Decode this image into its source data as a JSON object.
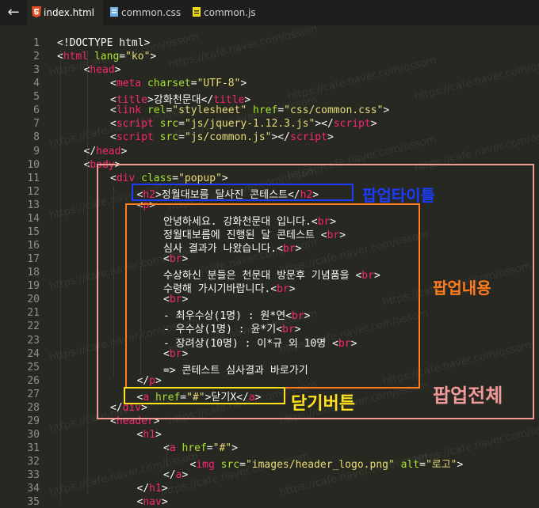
{
  "tabs": [
    {
      "label": "index.html",
      "icon": "html5-icon"
    },
    {
      "label": "common.css",
      "icon": "css-file-icon"
    },
    {
      "label": "common.js",
      "icon": "js-file-icon"
    }
  ],
  "watermark": "https://cafe.naver.com/ossom",
  "colors": {
    "tag": "#f92672",
    "attr": "#a6e22e",
    "string": "#e6db74",
    "text": "#f8f8f2",
    "linenum": "#8f908a",
    "bg": "#272822"
  },
  "lines": [
    {
      "n": "1",
      "indent": 0,
      "parts": [
        [
          "p",
          "<!DOCTYPE html>"
        ]
      ]
    },
    {
      "n": "2",
      "indent": 0,
      "parts": [
        [
          "p",
          "<"
        ],
        [
          "t",
          "html"
        ],
        [
          "p",
          " "
        ],
        [
          "a",
          "lang"
        ],
        [
          "p",
          "="
        ],
        [
          "s",
          "\"ko\""
        ],
        [
          "p",
          ">"
        ]
      ]
    },
    {
      "n": "3",
      "indent": 1,
      "parts": [
        [
          "p",
          "<"
        ],
        [
          "t",
          "head"
        ],
        [
          "p",
          ">"
        ]
      ]
    },
    {
      "n": "4",
      "indent": 2,
      "parts": [
        [
          "p",
          "<"
        ],
        [
          "t",
          "meta"
        ],
        [
          "p",
          " "
        ],
        [
          "a",
          "charset"
        ],
        [
          "p",
          "="
        ],
        [
          "s",
          "\"UTF-8\""
        ],
        [
          "p",
          ">"
        ]
      ]
    },
    {
      "n": "5",
      "indent": 2,
      "parts": [
        [
          "p",
          "<"
        ],
        [
          "t",
          "title"
        ],
        [
          "p",
          ">강화천문대</"
        ],
        [
          "t",
          "title"
        ],
        [
          "p",
          ">"
        ]
      ]
    },
    {
      "n": "6",
      "indent": 2,
      "parts": [
        [
          "p",
          "<"
        ],
        [
          "t",
          "link"
        ],
        [
          "p",
          " "
        ],
        [
          "a",
          "rel"
        ],
        [
          "p",
          "="
        ],
        [
          "s",
          "\"stylesheet\""
        ],
        [
          "p",
          " "
        ],
        [
          "a",
          "href"
        ],
        [
          "p",
          "="
        ],
        [
          "s",
          "\"css/common.css\""
        ],
        [
          "p",
          ">"
        ]
      ]
    },
    {
      "n": "7",
      "indent": 2,
      "parts": [
        [
          "p",
          "<"
        ],
        [
          "t",
          "script"
        ],
        [
          "p",
          " "
        ],
        [
          "a",
          "src"
        ],
        [
          "p",
          "="
        ],
        [
          "s",
          "\"js/jquery-1.12.3.js\""
        ],
        [
          "p",
          "></"
        ],
        [
          "t",
          "script"
        ],
        [
          "p",
          ">"
        ]
      ]
    },
    {
      "n": "8",
      "indent": 2,
      "parts": [
        [
          "p",
          "<"
        ],
        [
          "t",
          "script"
        ],
        [
          "p",
          " "
        ],
        [
          "a",
          "src"
        ],
        [
          "p",
          "="
        ],
        [
          "s",
          "\"js/common.js\""
        ],
        [
          "p",
          "></"
        ],
        [
          "t",
          "script"
        ],
        [
          "p",
          ">"
        ]
      ]
    },
    {
      "n": "9",
      "indent": 1,
      "parts": [
        [
          "p",
          "</"
        ],
        [
          "t",
          "head"
        ],
        [
          "p",
          ">"
        ]
      ]
    },
    {
      "n": "10",
      "indent": 1,
      "parts": [
        [
          "p",
          "<"
        ],
        [
          "t",
          "body"
        ],
        [
          "p",
          ">"
        ]
      ]
    },
    {
      "n": "11",
      "indent": 2,
      "parts": [
        [
          "p",
          "<"
        ],
        [
          "t",
          "div"
        ],
        [
          "p",
          " "
        ],
        [
          "a",
          "class"
        ],
        [
          "p",
          "="
        ],
        [
          "s",
          "\"popup\""
        ],
        [
          "p",
          ">"
        ]
      ]
    },
    {
      "n": "12",
      "indent": 3,
      "parts": [
        [
          "p",
          "<"
        ],
        [
          "t",
          "h2"
        ],
        [
          "p",
          ">정월대보름 달사진 콘테스트</"
        ],
        [
          "t",
          "h2"
        ],
        [
          "p",
          ">"
        ]
      ]
    },
    {
      "n": "13",
      "indent": 3,
      "parts": [
        [
          "p",
          "<"
        ],
        [
          "t",
          "p"
        ],
        [
          "p",
          ">"
        ]
      ]
    },
    {
      "n": "14",
      "indent": 4,
      "parts": [
        [
          "p",
          "안녕하세요. 강화천문대 입니다.<"
        ],
        [
          "t",
          "br"
        ],
        [
          "p",
          ">"
        ]
      ]
    },
    {
      "n": "15",
      "indent": 4,
      "parts": [
        [
          "p",
          "정월대보름에 진행된 달 콘테스트 <"
        ],
        [
          "t",
          "br"
        ],
        [
          "p",
          ">"
        ]
      ]
    },
    {
      "n": "16",
      "indent": 4,
      "parts": [
        [
          "p",
          "심사 결과가 나왔습니다.<"
        ],
        [
          "t",
          "br"
        ],
        [
          "p",
          ">"
        ]
      ]
    },
    {
      "n": "17",
      "indent": 4,
      "parts": [
        [
          "p",
          "<"
        ],
        [
          "t",
          "br"
        ],
        [
          "p",
          ">"
        ]
      ]
    },
    {
      "n": "18",
      "indent": 4,
      "parts": [
        [
          "p",
          "수상하신 분들은 천문대 방문후 기념품을 <"
        ],
        [
          "t",
          "br"
        ],
        [
          "p",
          ">"
        ]
      ]
    },
    {
      "n": "19",
      "indent": 4,
      "parts": [
        [
          "p",
          "수령해 가시기바랍니다.<"
        ],
        [
          "t",
          "br"
        ],
        [
          "p",
          ">"
        ]
      ]
    },
    {
      "n": "20",
      "indent": 4,
      "parts": [
        [
          "p",
          "<"
        ],
        [
          "t",
          "br"
        ],
        [
          "p",
          ">"
        ]
      ]
    },
    {
      "n": "21",
      "indent": 4,
      "parts": [
        [
          "p",
          "- 최우수상(1명) : 원*연<"
        ],
        [
          "t",
          "br"
        ],
        [
          "p",
          ">"
        ]
      ]
    },
    {
      "n": "22",
      "indent": 4,
      "parts": [
        [
          "p",
          "- 우수상(1명) : 윤*기<"
        ],
        [
          "t",
          "br"
        ],
        [
          "p",
          ">"
        ]
      ]
    },
    {
      "n": "23",
      "indent": 4,
      "parts": [
        [
          "p",
          "- 장려상(10명) : 이*규 외 10명 <"
        ],
        [
          "t",
          "br"
        ],
        [
          "p",
          ">"
        ]
      ]
    },
    {
      "n": "24",
      "indent": 4,
      "parts": [
        [
          "p",
          "<"
        ],
        [
          "t",
          "br"
        ],
        [
          "p",
          ">"
        ]
      ]
    },
    {
      "n": "25",
      "indent": 4,
      "parts": [
        [
          "p",
          "=> 콘테스트 심사결과 바로가기"
        ]
      ]
    },
    {
      "n": "26",
      "indent": 3,
      "parts": [
        [
          "p",
          "</"
        ],
        [
          "t",
          "p"
        ],
        [
          "p",
          ">"
        ]
      ]
    },
    {
      "n": "27",
      "indent": 3,
      "parts": [
        [
          "p",
          "<"
        ],
        [
          "t",
          "a"
        ],
        [
          "p",
          " "
        ],
        [
          "a",
          "href"
        ],
        [
          "p",
          "="
        ],
        [
          "s",
          "\"#\""
        ],
        [
          "p",
          ">닫기X</"
        ],
        [
          "t",
          "a"
        ],
        [
          "p",
          ">"
        ]
      ]
    },
    {
      "n": "28",
      "indent": 2,
      "parts": [
        [
          "p",
          "</"
        ],
        [
          "t",
          "div"
        ],
        [
          "p",
          ">"
        ]
      ]
    },
    {
      "n": "29",
      "indent": 2,
      "parts": [
        [
          "p",
          "<"
        ],
        [
          "t",
          "header"
        ],
        [
          "p",
          ">"
        ]
      ]
    },
    {
      "n": "30",
      "indent": 3,
      "parts": [
        [
          "p",
          "<"
        ],
        [
          "t",
          "h1"
        ],
        [
          "p",
          ">"
        ]
      ]
    },
    {
      "n": "31",
      "indent": 4,
      "parts": [
        [
          "p",
          "<"
        ],
        [
          "t",
          "a"
        ],
        [
          "p",
          " "
        ],
        [
          "a",
          "href"
        ],
        [
          "p",
          "="
        ],
        [
          "s",
          "\"#\""
        ],
        [
          "p",
          ">"
        ]
      ]
    },
    {
      "n": "32",
      "indent": 5,
      "parts": [
        [
          "p",
          "<"
        ],
        [
          "t",
          "img"
        ],
        [
          "p",
          " "
        ],
        [
          "a",
          "src"
        ],
        [
          "p",
          "="
        ],
        [
          "s",
          "\"images/header_logo.png\""
        ],
        [
          "p",
          " "
        ],
        [
          "a",
          "alt"
        ],
        [
          "p",
          "="
        ],
        [
          "s",
          "\"로고\""
        ],
        [
          "p",
          ">"
        ]
      ]
    },
    {
      "n": "33",
      "indent": 4,
      "parts": [
        [
          "p",
          "</"
        ],
        [
          "t",
          "a"
        ],
        [
          "p",
          ">"
        ]
      ]
    },
    {
      "n": "34",
      "indent": 3,
      "parts": [
        [
          "p",
          "</"
        ],
        [
          "t",
          "h1"
        ],
        [
          "p",
          ">"
        ]
      ]
    },
    {
      "n": "35",
      "indent": 3,
      "parts": [
        [
          "p",
          "<"
        ],
        [
          "t",
          "nav"
        ],
        [
          "p",
          ">"
        ]
      ]
    }
  ],
  "annotations": [
    {
      "name": "popup-title-annotation",
      "text": "팝업타이틀",
      "color": "#1a3cff"
    },
    {
      "name": "popup-content-annotation",
      "text": "팝업내용",
      "color": "#ff7b1c"
    },
    {
      "name": "popup-whole-annotation",
      "text": "팝업전체",
      "color": "#f29a9a"
    },
    {
      "name": "close-button-annotation",
      "text": "닫기버튼",
      "color": "#ffe21c"
    }
  ]
}
